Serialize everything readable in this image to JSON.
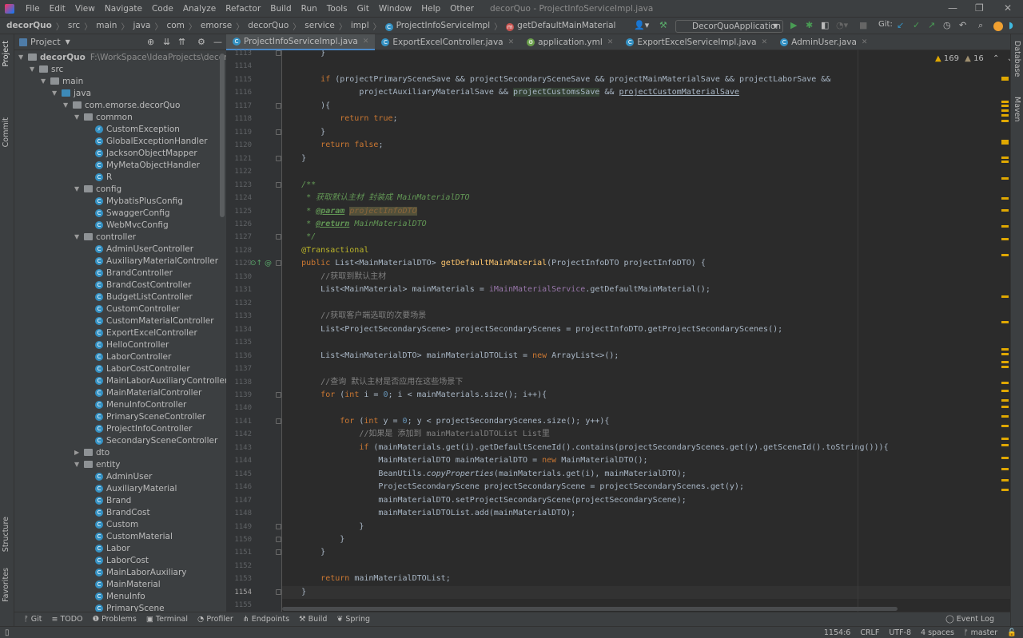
{
  "menu": [
    "File",
    "Edit",
    "View",
    "Navigate",
    "Code",
    "Analyze",
    "Refactor",
    "Build",
    "Run",
    "Tools",
    "Git",
    "Window",
    "Help",
    "Other"
  ],
  "window_title": "decorQuo - ProjectInfoServiceImpl.java",
  "breadcrumb": [
    "decorQuo",
    "src",
    "main",
    "java",
    "com",
    "emorse",
    "decorQuo",
    "service",
    "impl",
    "ProjectInfoServiceImpl",
    "getDefaultMainMaterial"
  ],
  "toolbar": {
    "run_config": "DecorQuoApplication",
    "git_label": "Git:"
  },
  "project_panel": {
    "title": "Project"
  },
  "tree": [
    {
      "level": 0,
      "type": "module",
      "label": "decorQuo",
      "path": "F:\\WorkSpace\\IdeaProjects\\decorQuo",
      "open": true
    },
    {
      "level": 1,
      "type": "folder",
      "label": "src",
      "open": true
    },
    {
      "level": 2,
      "type": "folder",
      "label": "main",
      "open": true
    },
    {
      "level": 3,
      "type": "src",
      "label": "java",
      "open": true
    },
    {
      "level": 4,
      "type": "package",
      "label": "com.emorse.decorQuo",
      "open": true
    },
    {
      "level": 5,
      "type": "package",
      "label": "common",
      "open": true
    },
    {
      "level": 6,
      "type": "class",
      "label": "CustomException"
    },
    {
      "level": 6,
      "type": "class",
      "label": "GlobalExceptionHandler"
    },
    {
      "level": 6,
      "type": "class",
      "label": "JacksonObjectMapper"
    },
    {
      "level": 6,
      "type": "class",
      "label": "MyMetaObjectHandler"
    },
    {
      "level": 6,
      "type": "class",
      "label": "R"
    },
    {
      "level": 5,
      "type": "package",
      "label": "config",
      "open": true
    },
    {
      "level": 6,
      "type": "class",
      "label": "MybatisPlusConfig"
    },
    {
      "level": 6,
      "type": "class",
      "label": "SwaggerConfig"
    },
    {
      "level": 6,
      "type": "class",
      "label": "WebMvcConfig"
    },
    {
      "level": 5,
      "type": "package",
      "label": "controller",
      "open": true
    },
    {
      "level": 6,
      "type": "class",
      "label": "AdminUserController"
    },
    {
      "level": 6,
      "type": "class",
      "label": "AuxiliaryMaterialController"
    },
    {
      "level": 6,
      "type": "class",
      "label": "BrandController"
    },
    {
      "level": 6,
      "type": "class",
      "label": "BrandCostController"
    },
    {
      "level": 6,
      "type": "class",
      "label": "BudgetListController"
    },
    {
      "level": 6,
      "type": "class",
      "label": "CustomController"
    },
    {
      "level": 6,
      "type": "class",
      "label": "CustomMaterialController"
    },
    {
      "level": 6,
      "type": "class",
      "label": "ExportExcelController"
    },
    {
      "level": 6,
      "type": "class",
      "label": "HelloController"
    },
    {
      "level": 6,
      "type": "class",
      "label": "LaborController"
    },
    {
      "level": 6,
      "type": "class",
      "label": "LaborCostController"
    },
    {
      "level": 6,
      "type": "class",
      "label": "MainLaborAuxiliaryController"
    },
    {
      "level": 6,
      "type": "class",
      "label": "MainMaterialController"
    },
    {
      "level": 6,
      "type": "class",
      "label": "MenuInfoController"
    },
    {
      "level": 6,
      "type": "class",
      "label": "PrimarySceneController"
    },
    {
      "level": 6,
      "type": "class",
      "label": "ProjectInfoController"
    },
    {
      "level": 6,
      "type": "class",
      "label": "SecondarySceneController"
    },
    {
      "level": 5,
      "type": "package",
      "label": "dto",
      "open": false
    },
    {
      "level": 5,
      "type": "package",
      "label": "entity",
      "open": true
    },
    {
      "level": 6,
      "type": "class",
      "label": "AdminUser"
    },
    {
      "level": 6,
      "type": "class",
      "label": "AuxiliaryMaterial"
    },
    {
      "level": 6,
      "type": "class",
      "label": "Brand"
    },
    {
      "level": 6,
      "type": "class",
      "label": "BrandCost"
    },
    {
      "level": 6,
      "type": "class",
      "label": "Custom"
    },
    {
      "level": 6,
      "type": "class",
      "label": "CustomMaterial"
    },
    {
      "level": 6,
      "type": "class",
      "label": "Labor"
    },
    {
      "level": 6,
      "type": "class",
      "label": "LaborCost"
    },
    {
      "level": 6,
      "type": "class",
      "label": "MainLaborAuxiliary"
    },
    {
      "level": 6,
      "type": "class",
      "label": "MainMaterial"
    },
    {
      "level": 6,
      "type": "class",
      "label": "MenuInfo"
    },
    {
      "level": 6,
      "type": "class",
      "label": "PrimaryScene"
    }
  ],
  "tabs": [
    {
      "label": "ProjectInfoServiceImpl.java",
      "active": true,
      "icon": "class"
    },
    {
      "label": "ExportExcelController.java",
      "icon": "class"
    },
    {
      "label": "application.yml",
      "icon": "yaml"
    },
    {
      "label": "ExportExcelServiceImpl.java",
      "icon": "class"
    },
    {
      "label": "AdminUser.java",
      "icon": "class"
    }
  ],
  "inspections": {
    "warnings": "169",
    "weak_warnings": "16"
  },
  "editor": {
    "first_line": 1113,
    "current_line": 1154,
    "lines": [
      "        }",
      "",
      "        if (projectPrimarySceneSave && projectSecondarySceneSave && projectMainMaterialSave && projectLaborSave &&",
      "                projectAuxiliaryMaterialSave && projectCustomsSave && projectCustomMaterialSave",
      "        ){",
      "            return true;",
      "        }",
      "        return false;",
      "    }",
      "",
      "    /**",
      "     * 获取默认主材 封装成 MainMaterialDTO",
      "     * @param projectInfoDTO",
      "     * @return MainMaterialDTO",
      "     */",
      "    @Transactional",
      "    public List<MainMaterialDTO> getDefaultMainMaterial(ProjectInfoDTO projectInfoDTO) {",
      "        //获取到默认主材",
      "        List<MainMaterial> mainMaterials = iMainMaterialService.getDefaultMainMaterial();",
      "",
      "        //获取客户端选取的次要场景",
      "        List<ProjectSecondaryScene> projectSecondaryScenes = projectInfoDTO.getProjectSecondaryScenes();",
      "",
      "        List<MainMaterialDTO> mainMaterialDTOList = new ArrayList<>();",
      "",
      "        //查询 默认主材是否应用在这些场景下",
      "        for (int i = 0; i < mainMaterials.size(); i++){",
      "",
      "            for (int y = 0; y < projectSecondaryScenes.size(); y++){",
      "                //如果是 添加到 mainMaterialDTOList List里",
      "                if (mainMaterials.get(i).getDefaultSceneId().contains(projectSecondaryScenes.get(y).getSceneId().toString())){",
      "                    MainMaterialDTO mainMaterialDTO = new MainMaterialDTO();",
      "                    BeanUtils.copyProperties(mainMaterials.get(i), mainMaterialDTO);",
      "                    ProjectSecondaryScene projectSecondaryScene = projectSecondaryScenes.get(y);",
      "                    mainMaterialDTO.setProjectSecondaryScene(projectSecondaryScene);",
      "                    mainMaterialDTOList.add(mainMaterialDTO);",
      "                }",
      "            }",
      "        }",
      "",
      "        return mainMaterialDTOList;",
      "    }",
      ""
    ]
  },
  "left_stripe": [
    "Project",
    "Commit",
    "Structure",
    "Favorites"
  ],
  "right_stripe": [
    "Database",
    "Maven"
  ],
  "tool_windows": [
    "Git",
    "TODO",
    "Problems",
    "Terminal",
    "Profiler",
    "Endpoints",
    "Build",
    "Spring"
  ],
  "event_log": "Event Log",
  "status": {
    "position": "1154:6",
    "line_sep": "CRLF",
    "encoding": "UTF-8",
    "indent": "4 spaces",
    "branch": "master"
  },
  "colors": {
    "accent": "#4a88c7",
    "keyword": "#cc7832",
    "comment": "#808080",
    "doc": "#629755",
    "annotation": "#bbb529",
    "warning": "#e0a800"
  }
}
